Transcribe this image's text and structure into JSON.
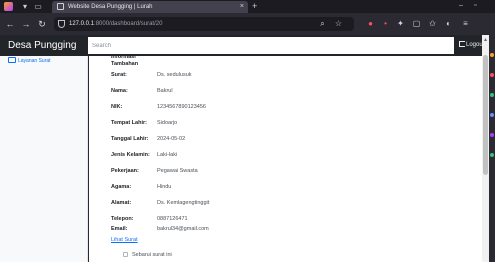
{
  "browser": {
    "tab_title": "Website Desa Pungging | Lurah",
    "tab_close": "×",
    "new_tab": "+",
    "url_host": "127.0.0.1",
    "url_path": ":8000/dashboard/surat/20",
    "colors": {
      "chrome": "#1c1b22",
      "toolbar": "#2b2a33",
      "tab": "#42414d"
    }
  },
  "app": {
    "brand": "Desa Pungging",
    "search_placeholder": "Search",
    "logout_label": "Logout",
    "sidebar": {
      "items": [
        {
          "label": "Layanan Surat",
          "icon": "envelope-icon"
        }
      ]
    },
    "detail": {
      "section_heading": "Informasi Tambahan",
      "fields": [
        {
          "label": "Surat:",
          "value": "Ds. sedulusuk"
        },
        {
          "label": "Nama:",
          "value": "Bakrul"
        },
        {
          "label": "NIK:",
          "value": "1234567890123456"
        },
        {
          "label": "Tempat Lahir:",
          "value": "Sidoarjo"
        },
        {
          "label": "Tanggal Lahir:",
          "value": "2024-05-02"
        },
        {
          "label": "Jenis Kelamin:",
          "value": "Laki-laki"
        },
        {
          "label": "Pekerjaan:",
          "value": "Pegawai Swasta"
        },
        {
          "label": "Agama:",
          "value": "Hindu"
        },
        {
          "label": "Alamat:",
          "value": "Ds. Kemlagengtinggit"
        },
        {
          "label": "Telepon:",
          "value": "0887126471"
        },
        {
          "label": "Email:",
          "value": "bakrul34@gmail.com"
        }
      ],
      "link_label": "Lihat Surat",
      "checkbox_label": "Sebarui surat ini"
    },
    "colors": {
      "header": "#212529",
      "link": "#0d6efd",
      "sidebar": "#f8f9fa"
    }
  }
}
